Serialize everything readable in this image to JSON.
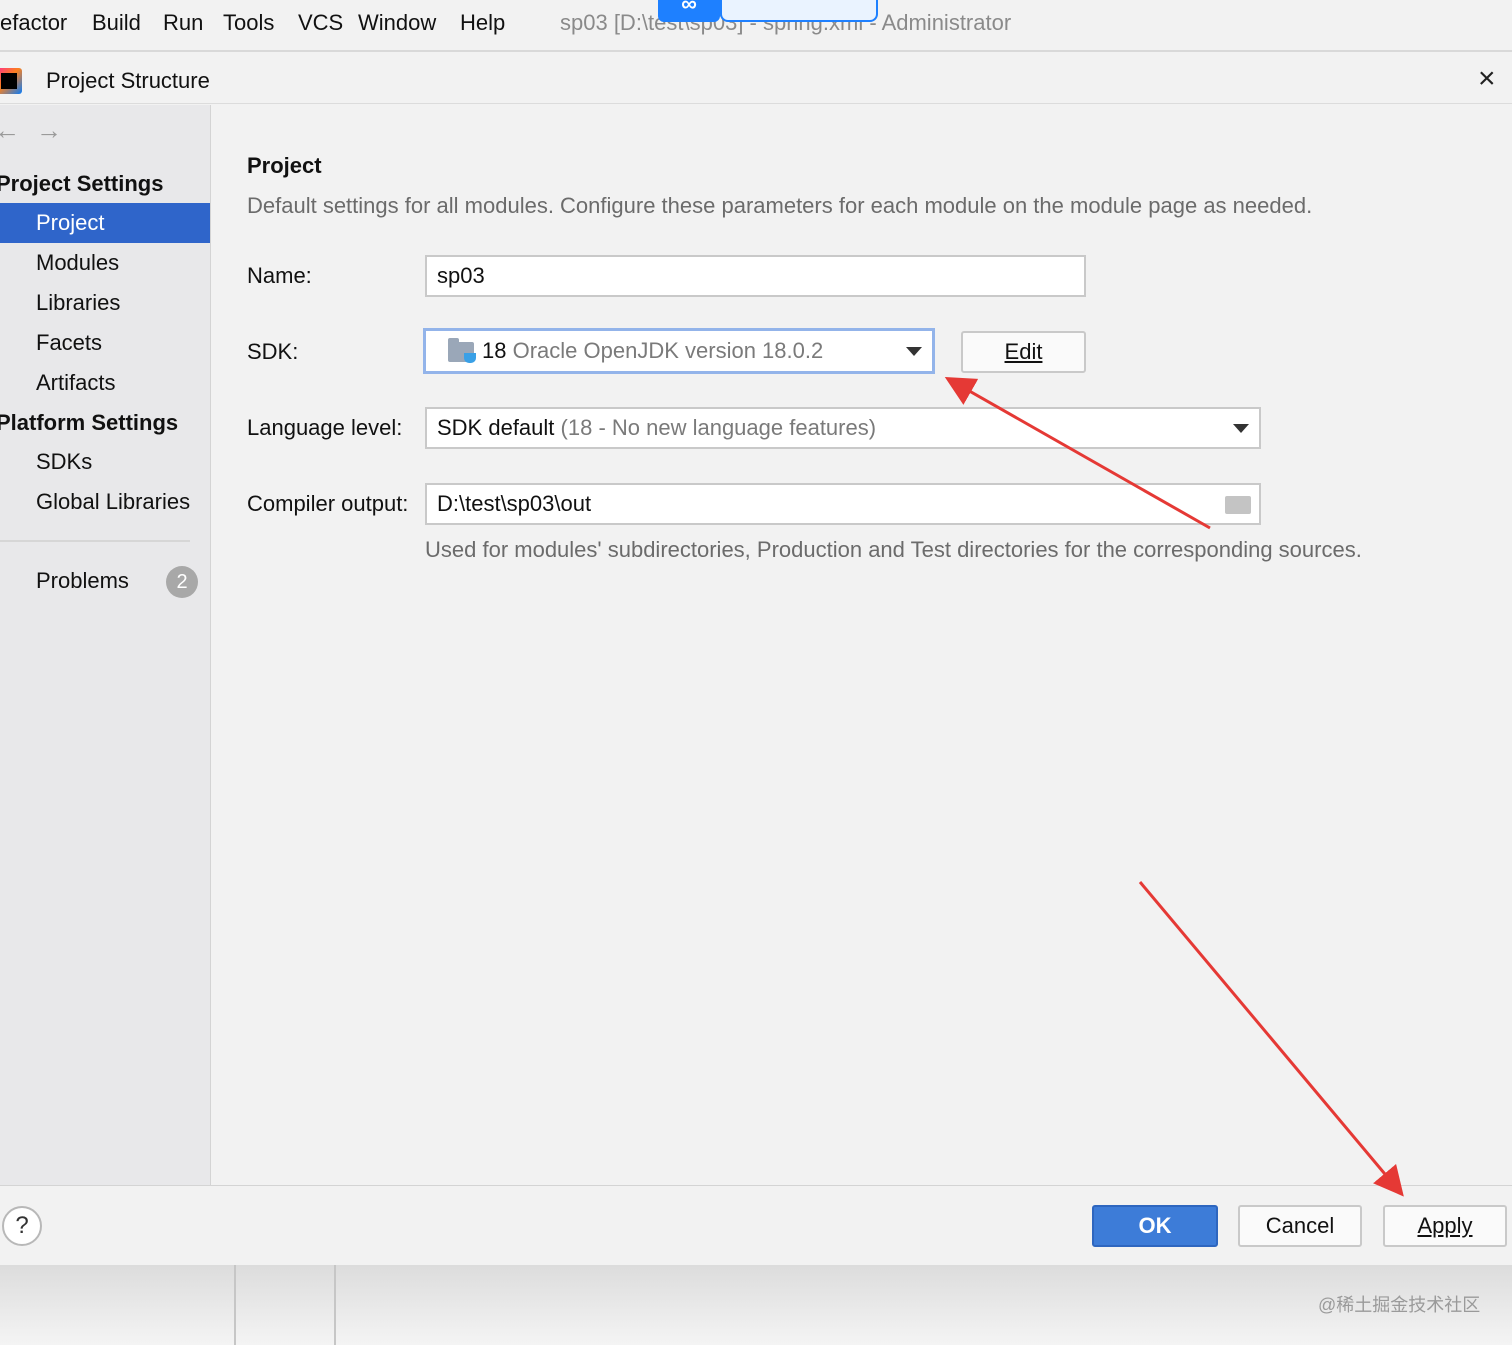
{
  "menubar": {
    "items": [
      "efactor",
      "Build",
      "Run",
      "Tools",
      "VCS",
      "Window",
      "Help"
    ],
    "window_title": "sp03 [D:\\test\\sp03] - spring.xml - Administrator",
    "badge_text": "∞"
  },
  "dialog": {
    "title": "Project Structure",
    "close_glyph": "×"
  },
  "sidebar": {
    "back_glyph": "←",
    "forward_glyph": "→",
    "project_settings_header": "Project Settings",
    "project_settings_items": [
      "Project",
      "Modules",
      "Libraries",
      "Facets",
      "Artifacts"
    ],
    "selected_item": "Project",
    "platform_settings_header": "Platform Settings",
    "platform_settings_items": [
      "SDKs",
      "Global Libraries"
    ],
    "problems_label": "Problems",
    "problems_count": "2"
  },
  "main": {
    "title": "Project",
    "description": "Default settings for all modules. Configure these parameters for each module on the module page as needed.",
    "name_label": "Name:",
    "name_value": "sp03",
    "sdk_label": "SDK:",
    "sdk_version_number": "18",
    "sdk_version_detail": "Oracle OpenJDK version 18.0.2",
    "edit_button": "Edit",
    "language_level_label": "Language level:",
    "language_level_value": "SDK default",
    "language_level_detail": "(18 - No new language features)",
    "compiler_output_label": "Compiler output:",
    "compiler_output_value": "D:\\test\\sp03\\out",
    "compiler_output_hint": "Used for modules' subdirectories, Production and Test directories for the corresponding sources."
  },
  "footer": {
    "help_glyph": "?",
    "ok_button": "OK",
    "cancel_button": "Cancel",
    "apply_button": "Apply"
  },
  "watermark": "@稀土掘金技术社区",
  "colors": {
    "selection": "#2f65ca",
    "ok_button": "#3d7cd8",
    "annotation_arrow": "#e53935"
  }
}
